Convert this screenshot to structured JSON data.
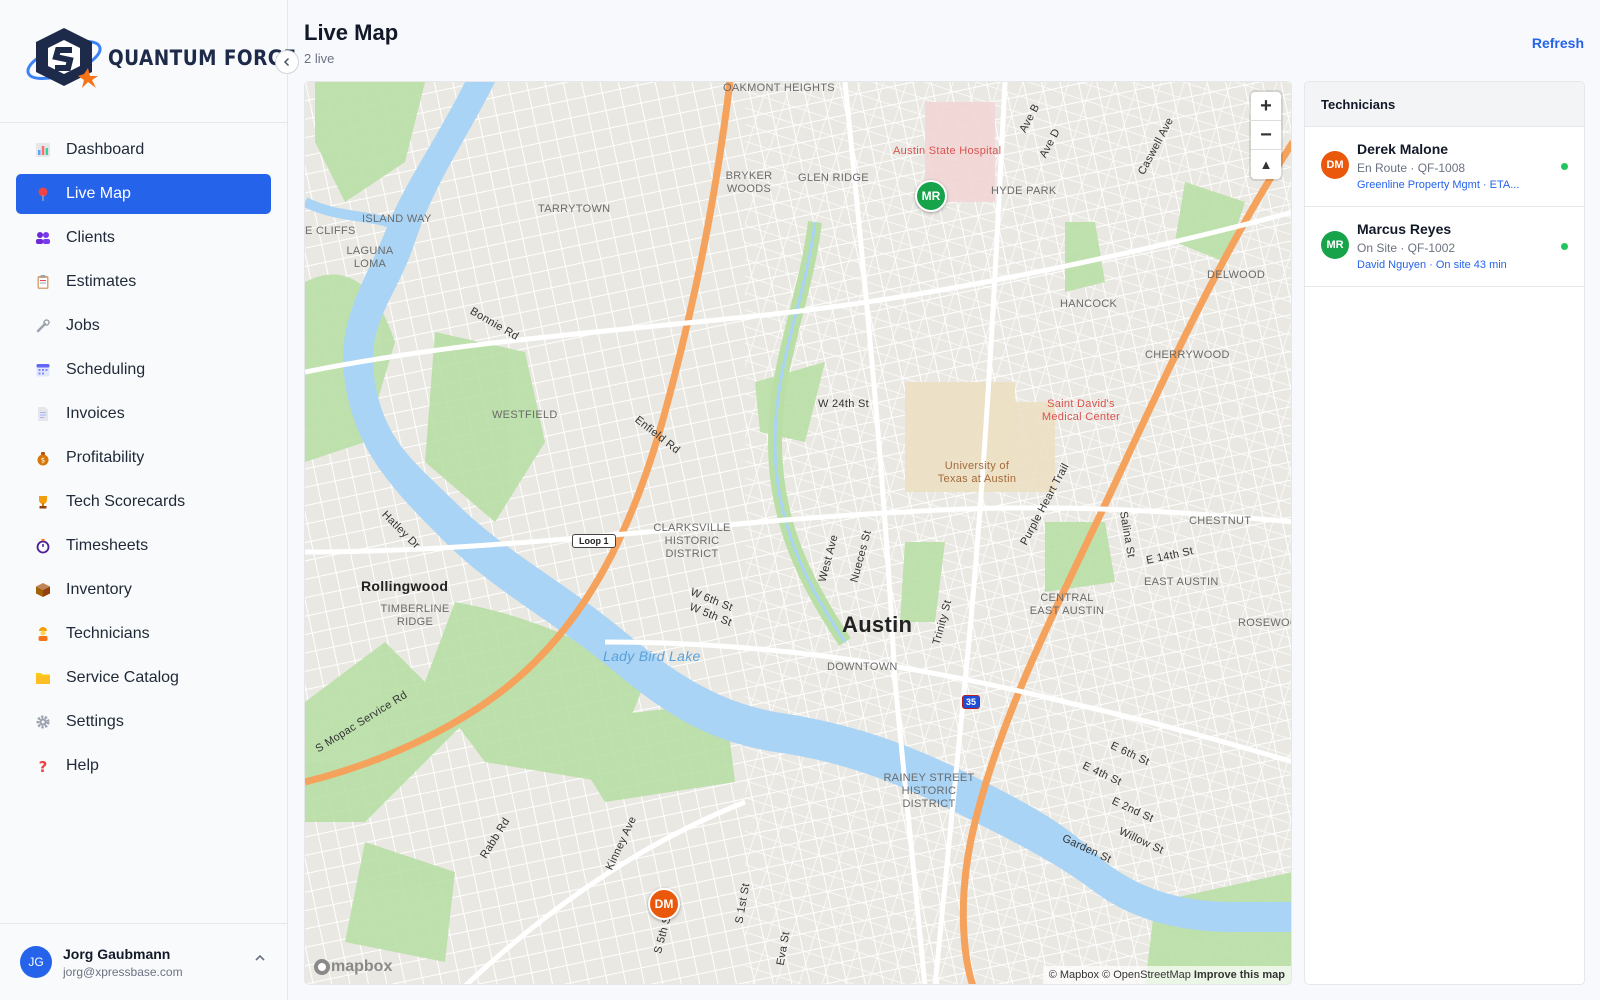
{
  "brand": {
    "name": "QUANTUM FORGE"
  },
  "nav": [
    {
      "label": "Dashboard",
      "icon": "bar-chart-icon",
      "active": false
    },
    {
      "label": "Live Map",
      "icon": "map-pin-icon",
      "active": true
    },
    {
      "label": "Clients",
      "icon": "users-icon",
      "active": false
    },
    {
      "label": "Estimates",
      "icon": "clipboard-icon",
      "active": false
    },
    {
      "label": "Jobs",
      "icon": "wrench-icon",
      "active": false
    },
    {
      "label": "Scheduling",
      "icon": "calendar-icon",
      "active": false
    },
    {
      "label": "Invoices",
      "icon": "document-icon",
      "active": false
    },
    {
      "label": "Profitability",
      "icon": "money-bag-icon",
      "active": false
    },
    {
      "label": "Tech Scorecards",
      "icon": "trophy-icon",
      "active": false
    },
    {
      "label": "Timesheets",
      "icon": "stopwatch-icon",
      "active": false
    },
    {
      "label": "Inventory",
      "icon": "box-icon",
      "active": false
    },
    {
      "label": "Technicians",
      "icon": "worker-icon",
      "active": false
    },
    {
      "label": "Service Catalog",
      "icon": "folder-icon",
      "active": false
    },
    {
      "label": "Settings",
      "icon": "gear-icon",
      "active": false
    },
    {
      "label": "Help",
      "icon": "question-icon",
      "active": false
    }
  ],
  "user": {
    "initials": "JG",
    "name": "Jorg Gaubmann",
    "email": "jorg@xpressbase.com"
  },
  "header": {
    "title": "Live Map",
    "subtitle": "2 live",
    "refresh_label": "Refresh"
  },
  "map": {
    "zoom_in": "+",
    "zoom_out": "−",
    "compass": "▲",
    "logo": "mapbox",
    "attribution": "© Mapbox © OpenStreetMap",
    "improve": "Improve this map",
    "labels": {
      "oakmont": "OAKMONT HEIGHTS",
      "hospital": "Austin State Hospital",
      "bryker": "BRYKER WOODS",
      "glen_ridge": "GLEN RIDGE",
      "hyde_park": "HYDE PARK",
      "tarrytown": "TARRYTOWN",
      "island_way": "ISLAND WAY",
      "e_cliffs": "E CLIFFS",
      "laguna": "LAGUNA LOMA",
      "delwood": "DELWOOD",
      "hancock": "HANCOCK",
      "bonnie": "Bonnie Rd",
      "cherrywood": "CHERRYWOOD",
      "w24": "W 24th St",
      "st_davids": "Saint David's Medical Center",
      "westfield": "WESTFIELD",
      "enfield": "Enfield Rd",
      "ut": "University of Texas at Austin",
      "clarksville": "CLARKSVILLE HISTORIC DISTRICT",
      "loop1": "Loop 1",
      "chestnut": "CHESTNUT",
      "e14": "E 14th St",
      "east_austin": "EAST AUSTIN",
      "rollingwood": "Rollingwood",
      "timberline": "TIMBERLINE RIDGE",
      "w6": "W 6th St",
      "w5": "W 5th St",
      "austin": "Austin",
      "central_east": "CENTRAL EAST AUSTIN",
      "rosewood": "ROSEWOO",
      "downtown": "DOWNTOWN",
      "lady_bird": "Lady Bird Lake",
      "mopac": "S Mopac Service Rd",
      "hatley": "Hatley Dr",
      "purple_heart": "Purple Heart Trail",
      "trinity": "Trinity St",
      "nueces": "Nueces St",
      "west_ave": "West Ave",
      "salina": "Salina St",
      "i35": "35",
      "e6": "E 6th St",
      "e4": "E 4th St",
      "e2": "E 2nd St",
      "willow": "Willow St",
      "garden": "Garden St",
      "rainey": "RAINEY STREET HISTORIC DISTRICT",
      "rabb": "Rabb Rd",
      "kinney": "Kinney Ave",
      "s1": "S 1st St",
      "s5": "S 5th St",
      "eva": "Eva St",
      "ave_b": "Ave B",
      "ave_d": "Ave D",
      "caswell": "Caswell Ave"
    },
    "markers": [
      {
        "initials": "MR",
        "color": "#16a34a"
      },
      {
        "initials": "DM",
        "color": "#ea580c"
      }
    ]
  },
  "panel": {
    "title": "Technicians",
    "technicians": [
      {
        "initials": "DM",
        "name": "Derek Malone",
        "status": "En Route · QF-1008",
        "detail": "Greenline Property Mgmt · ETA...",
        "color": "#ea580c"
      },
      {
        "initials": "MR",
        "name": "Marcus Reyes",
        "status": "On Site · QF-1002",
        "detail": "David Nguyen · On site 43 min",
        "color": "#16a34a"
      }
    ]
  }
}
